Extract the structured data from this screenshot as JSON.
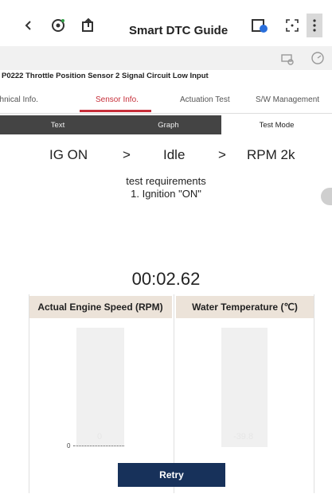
{
  "header": {
    "title": "Smart DTC Guide"
  },
  "dtc": {
    "title": "P0222 Throttle Position Sensor 2 Signal Circuit Low Input"
  },
  "tabs": [
    "Technical Info.",
    "Sensor Info.",
    "Actuation Test",
    "S/W Management"
  ],
  "active_tab": "Sensor Info.",
  "segments": [
    "Text",
    "Graph",
    "Test Mode"
  ],
  "active_segment": "Test Mode",
  "steps": {
    "s1": "IG ON",
    "arrow1": ">",
    "s2": "Idle",
    "arrow2": ">",
    "s3": "RPM 2k"
  },
  "requirements": {
    "title": "test requirements",
    "line1": "1. Ignition \"ON\""
  },
  "timer": "00:02.62",
  "gauges": [
    {
      "label": "Actual Engine Speed (RPM)",
      "value": "0",
      "axis_value": "0"
    },
    {
      "label": "Water Temperature (℃)",
      "value": "-39.8"
    }
  ],
  "retry_label": "Retry",
  "colors": {
    "accent": "#c62f3a",
    "segment_dark": "#444444",
    "header_beige": "#ece3d9",
    "button_navy": "#17315a"
  }
}
